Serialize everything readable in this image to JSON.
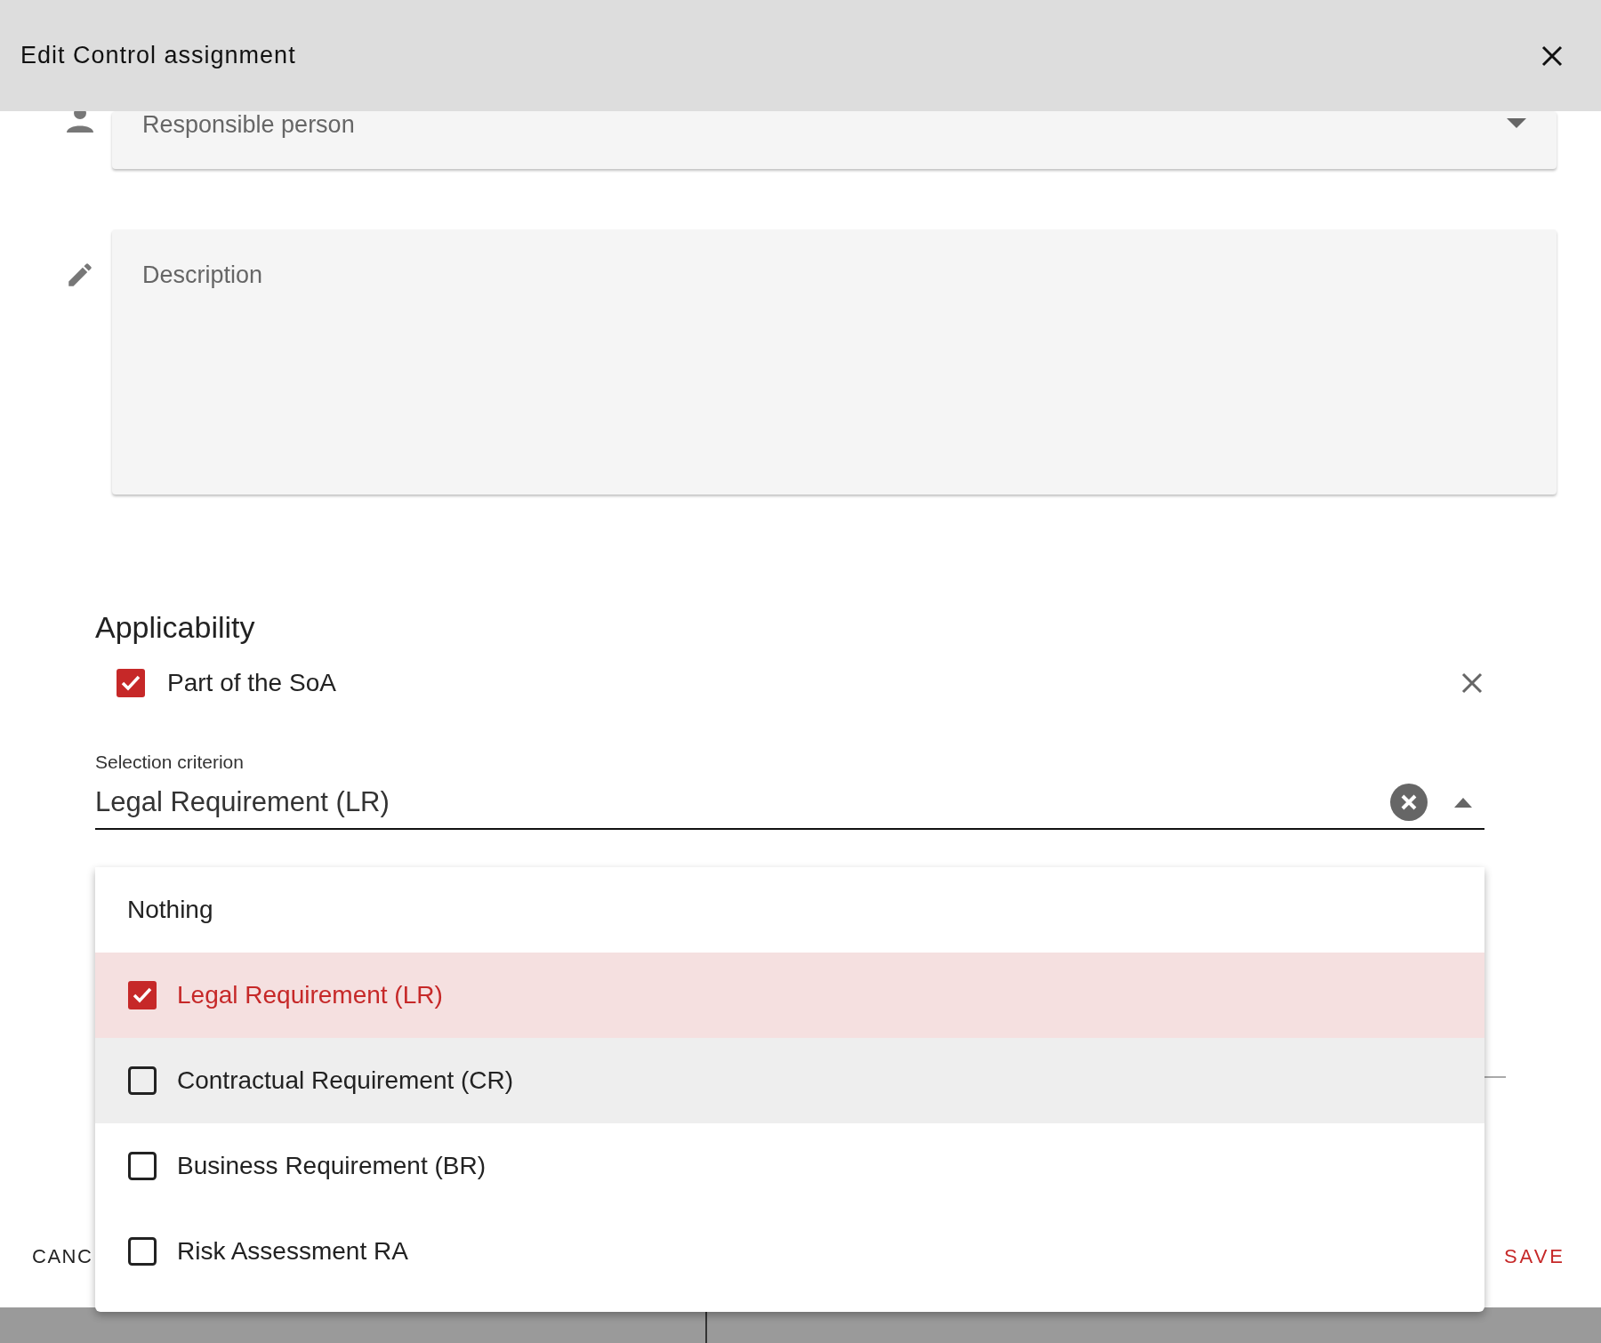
{
  "dialog": {
    "title": "Edit Control assignment"
  },
  "responsible": {
    "placeholder": "Responsible person"
  },
  "description": {
    "placeholder": "Description"
  },
  "applicability": {
    "heading": "Applicability",
    "soa": {
      "label": "Part of the SoA",
      "checked": true
    }
  },
  "selection": {
    "label": "Selection criterion",
    "value": "Legal Requirement (LR)",
    "expanded": true
  },
  "menu": [
    {
      "label": "Nothing",
      "kind": "plain",
      "selected": false,
      "highlighted": false
    },
    {
      "label": "Legal Requirement (LR)",
      "kind": "checkbox",
      "selected": true,
      "highlighted": false
    },
    {
      "label": "Contractual Requirement (CR)",
      "kind": "checkbox",
      "selected": false,
      "highlighted": true
    },
    {
      "label": "Business Requirement (BR)",
      "kind": "checkbox",
      "selected": false,
      "highlighted": false
    },
    {
      "label": "Risk Assessment RA",
      "kind": "checkbox",
      "selected": false,
      "highlighted": false
    }
  ],
  "buttons": {
    "cancel": "CANC",
    "save": "SAVE"
  }
}
